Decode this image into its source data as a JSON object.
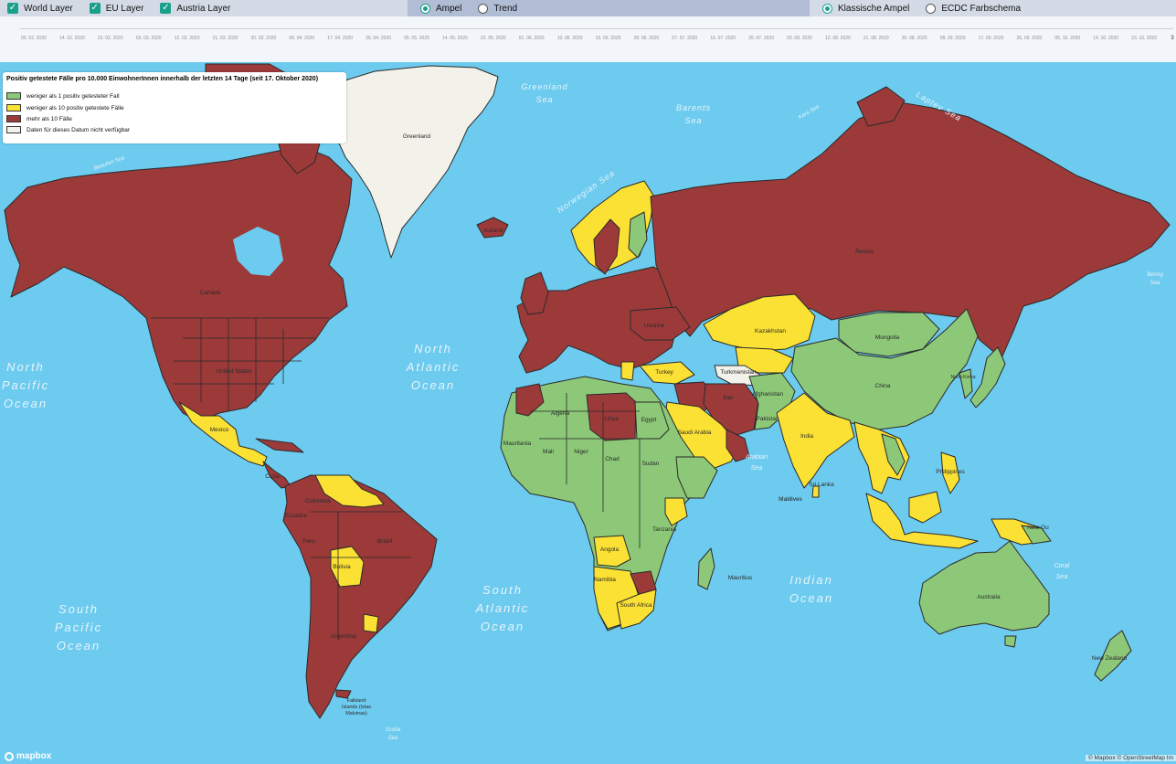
{
  "controls": {
    "layers": [
      {
        "label": "World Layer",
        "checked": true
      },
      {
        "label": "EU Layer",
        "checked": true
      },
      {
        "label": "Austria Layer",
        "checked": true
      }
    ],
    "mode": [
      {
        "label": "Ampel",
        "selected": true
      },
      {
        "label": "Trend",
        "selected": false
      }
    ],
    "scheme": [
      {
        "label": "Klassische Ampel",
        "selected": true
      },
      {
        "label": "ECDC Farbschema",
        "selected": false
      }
    ]
  },
  "timeline": {
    "dates": [
      "05. 02. 2020",
      "14. 02. 2020",
      "23. 02. 2020",
      "03. 03. 2020",
      "12. 03. 2020",
      "21. 03. 2020",
      "30. 03. 2020",
      "08. 04. 2020",
      "17. 04. 2020",
      "26. 04. 2020",
      "05. 05. 2020",
      "14. 05. 2020",
      "23. 05. 2020",
      "01. 06. 2020",
      "10. 06. 2020",
      "19. 06. 2020",
      "28. 06. 2020",
      "07. 07. 2020",
      "16. 07. 2020",
      "25. 07. 2020",
      "03. 08. 2020",
      "12. 08. 2020",
      "21. 08. 2020",
      "30. 08. 2020",
      "08. 09. 2020",
      "17. 09. 2020",
      "26. 09. 2020",
      "05. 10. 2020",
      "14. 10. 2020",
      "23. 10. 2020"
    ],
    "end_label": "3"
  },
  "legend": {
    "title": "Positiv getestete Fälle pro 10.000 EinwohnerInnen innerhalb der letzten 14 Tage (seit 17. Oktober 2020)",
    "items": [
      {
        "label": "weniger als 1 positiv getesteter Fall",
        "color": "#8cc878"
      },
      {
        "label": "weniger als 10 positiv getestete Fälle",
        "color": "#fbe133"
      },
      {
        "label": "mehr als 10 Fälle",
        "color": "#9c3a3a"
      },
      {
        "label": "Daten für dieses Datum nicht verfügbar",
        "color": "#f2f2ea"
      }
    ]
  },
  "colors": {
    "ocean": "#6dcbef",
    "green": "#8cc878",
    "yellow": "#fbe133",
    "red": "#9c3a3a",
    "nodata": "#f2f2ea",
    "teal": "#1a9f8a"
  },
  "map_labels": {
    "countries": [
      "Greenland",
      "Canada",
      "United States",
      "Mexico",
      "Cuba",
      "Colombia",
      "Ecuador",
      "Peru",
      "Bolivia",
      "Brazil",
      "Argentina",
      "Falkland Islands (Islas Malvinas)",
      "Iceland",
      "Russia",
      "Kazakhstan",
      "Mongolia",
      "China",
      "North Korea",
      "Japan",
      "Turkmenistan",
      "Turkey",
      "Iran",
      "Afghanistan",
      "Pakistan",
      "India",
      "Sri Lanka",
      "Maldives",
      "Philippines",
      "New Guinea",
      "Australia",
      "New Zealand",
      "Ukraine",
      "Algeria",
      "Libya",
      "Egypt",
      "Mauritania",
      "Mali",
      "Niger",
      "Chad",
      "Sudan",
      "Saudi Arabia",
      "Angola",
      "Namibia",
      "Tanzania",
      "Mauritius",
      "South Africa"
    ],
    "seas": [
      "Greenland Sea",
      "Barents Sea",
      "Laptev Sea",
      "Kara Sea",
      "Norwegian Sea",
      "Beaufort Sea",
      "North Atlantic Ocean",
      "North Pacific Ocean",
      "South Atlantic Ocean",
      "South Pacific Ocean",
      "Indian Ocean",
      "Arabian Sea",
      "Coral Sea",
      "Bering Sea",
      "Scotia Sea"
    ]
  },
  "attribution": {
    "logo": "mapbox",
    "text": "© Mapbox © OpenStreetMap Im"
  }
}
